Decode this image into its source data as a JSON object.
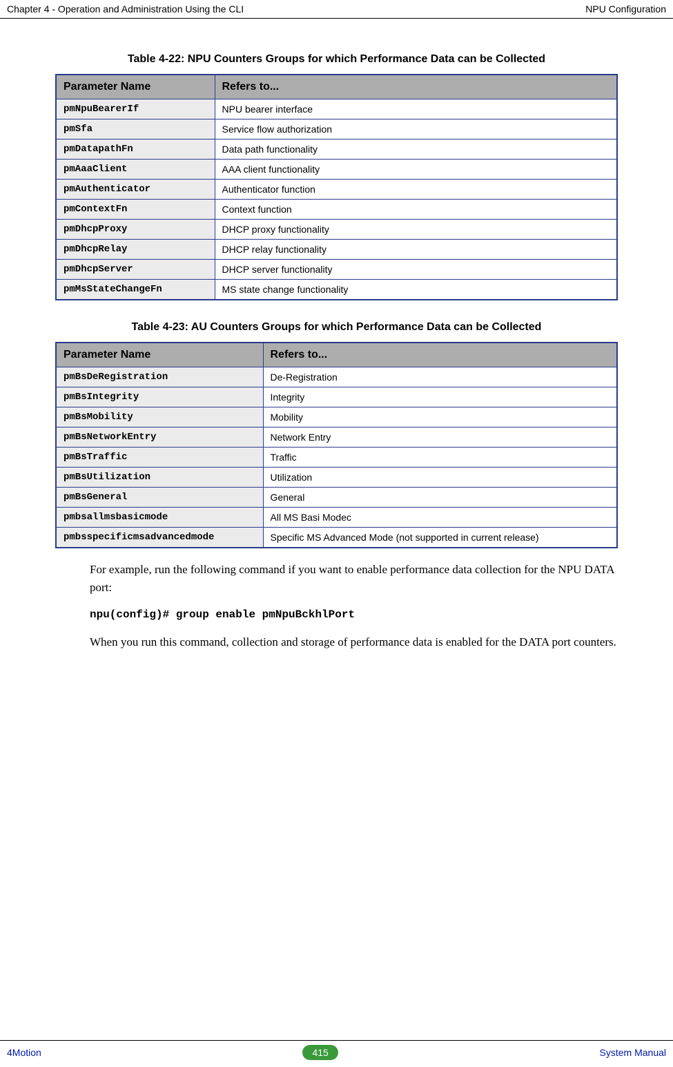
{
  "header": {
    "left": "Chapter 4 - Operation and Administration Using the CLI",
    "right": "NPU Configuration"
  },
  "table22": {
    "caption": "Table 4-22: NPU Counters Groups for which Performance Data can be Collected",
    "headers": {
      "c1": "Parameter Name",
      "c2": "Refers to..."
    },
    "rows": [
      {
        "p": "pmNpuBearerIf",
        "r": "NPU bearer interface"
      },
      {
        "p": "pmSfa",
        "r": "Service flow authorization"
      },
      {
        "p": "pmDatapathFn",
        "r": "Data path functionality"
      },
      {
        "p": "pmAaaClient",
        "r": "AAA client functionality"
      },
      {
        "p": "pmAuthenticator",
        "r": "Authenticator function"
      },
      {
        "p": "pmContextFn",
        "r": "Context function"
      },
      {
        "p": "pmDhcpProxy",
        "r": "DHCP proxy functionality"
      },
      {
        "p": "pmDhcpRelay",
        "r": "DHCP relay functionality"
      },
      {
        "p": "pmDhcpServer",
        "r": "DHCP server functionality"
      },
      {
        "p": "pmMsStateChangeFn",
        "r": "MS state change functionality"
      }
    ]
  },
  "table23": {
    "caption": "Table 4-23: AU Counters Groups for which Performance Data can be Collected",
    "headers": {
      "c1": "Parameter Name",
      "c2": "Refers to..."
    },
    "rows": [
      {
        "p": "pmBsDeRegistration",
        "r": "De-Registration"
      },
      {
        "p": "pmBsIntegrity",
        "r": "Integrity"
      },
      {
        "p": "pmBsMobility",
        "r": "Mobility"
      },
      {
        "p": "pmBsNetworkEntry",
        "r": "Network Entry"
      },
      {
        "p": "pmBsTraffic",
        "r": "Traffic"
      },
      {
        "p": "pmBsUtilization",
        "r": "Utilization"
      },
      {
        "p": "pmBsGeneral",
        "r": "General"
      },
      {
        "p": "pmbsallmsbasicmode",
        "r": "All MS Basi Modec"
      },
      {
        "p": "pmbsspecificmsadvancedmode",
        "r": "Specific MS Advanced Mode  (not supported in current release)"
      }
    ]
  },
  "para1": "For example, run the following command if you want to enable performance data collection for the NPU DATA port:",
  "command": "npu(config)# group enable pmNpuBckhlPort",
  "para2": "When you run this command, collection and storage of performance data is enabled for the DATA port counters.",
  "footer": {
    "left": "4Motion",
    "page": "415",
    "right": "System Manual"
  }
}
